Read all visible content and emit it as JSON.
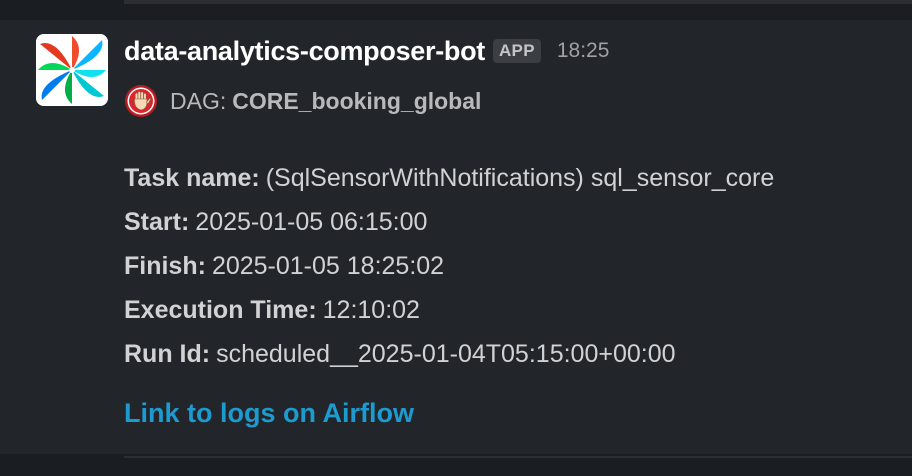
{
  "message": {
    "sender": "data-analytics-composer-bot",
    "badge": "APP",
    "time": "18:25",
    "dag_prefix": "DAG:",
    "dag_name": "CORE_booking_global",
    "details": [
      {
        "label": "Task name:",
        "value": "(SqlSensorWithNotifications) sql_sensor_core"
      },
      {
        "label": "Start:",
        "value": "2025-01-05 06:15:00"
      },
      {
        "label": "Finish:",
        "value": "2025-01-05 18:25:02"
      },
      {
        "label": "Execution Time:",
        "value": "12:10:02"
      },
      {
        "label": "Run Id:",
        "value": "scheduled__2025-01-04T05:15:00+00:00"
      }
    ],
    "link_text": "Link to logs on Airflow"
  },
  "icons": {
    "avatar": "airflow-pinwheel-logo",
    "status": "raised-hand-stop-icon"
  },
  "colors": {
    "background": "#1a1d21",
    "message_background": "#222529",
    "link": "#1d9bd1",
    "stop_red": "#d9262c"
  }
}
